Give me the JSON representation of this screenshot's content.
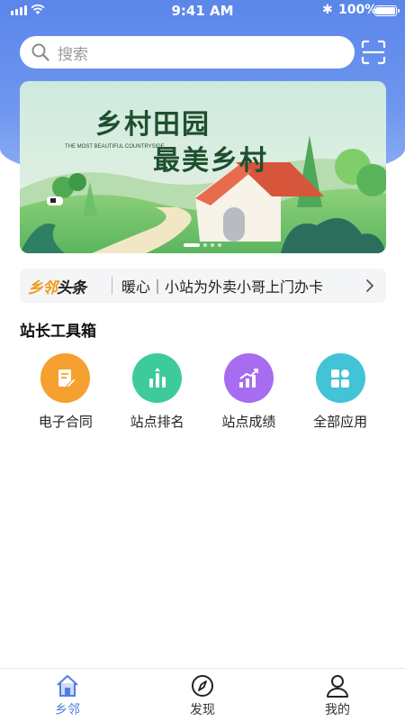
{
  "status_bar": {
    "time": "9:41 AM",
    "battery": "100%"
  },
  "search": {
    "placeholder": "搜索"
  },
  "banner": {
    "title_line1": "乡村田园",
    "subtitle": "THE MOST BEAUTIFUL COUNTRYSIDE",
    "title_line2": "最美乡村",
    "slide_count": 4,
    "active_slide": 1
  },
  "headline": {
    "logo_part1": "乡邻",
    "logo_part2": "头条",
    "text": "暖心｜小站为外卖小哥上门办卡"
  },
  "toolbox": {
    "title": "站长工具箱",
    "items": [
      {
        "label": "电子合同",
        "icon": "contract-icon",
        "color": "#f5a02f"
      },
      {
        "label": "站点排名",
        "icon": "ranking-icon",
        "color": "#3ecb9a"
      },
      {
        "label": "站点成绩",
        "icon": "growth-chart-icon",
        "color": "#a86cf0"
      },
      {
        "label": "全部应用",
        "icon": "apps-grid-icon",
        "color": "#42c3d6"
      }
    ]
  },
  "tabbar": {
    "active_color": "#4f7fe3",
    "tabs": [
      {
        "label": "乡邻",
        "icon": "home-icon",
        "active": true
      },
      {
        "label": "发现",
        "icon": "compass-icon",
        "active": false
      },
      {
        "label": "我的",
        "icon": "user-icon",
        "active": false
      }
    ]
  }
}
